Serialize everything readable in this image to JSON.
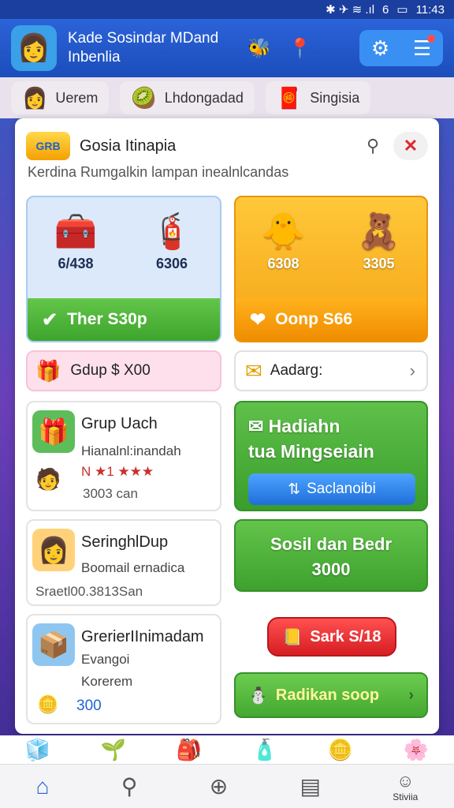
{
  "status": {
    "time": "11:43",
    "battery": "6",
    "signals": "✱ ✈ ≋ .ıl"
  },
  "appbar": {
    "logo": "👩",
    "title_line1": "Kade Sosindar MDand",
    "title_line2": "Inbenlia",
    "icons": [
      "🐝",
      "📍"
    ],
    "action_icons": [
      "⚙",
      "☰"
    ]
  },
  "chips": [
    {
      "icon": "👩",
      "label": "Uerem"
    },
    {
      "icon": "🥝",
      "label": "Lhdongadad"
    },
    {
      "icon": "🧧",
      "label": "Singisia"
    }
  ],
  "panel": {
    "logo": "GRB",
    "title": "Gosia Itinapia",
    "subtitle": "Kerdina Rumgalkin lampan inealnlcandas",
    "blue_card": {
      "items": [
        {
          "icon": "🧰",
          "value": "6/438"
        },
        {
          "icon": "🧯",
          "value": "6306"
        }
      ],
      "bar_icon": "✔",
      "bar_label": "Ther S30p"
    },
    "orange_card": {
      "items": [
        {
          "icon": "🐥",
          "value": "6308"
        },
        {
          "icon": "🧸",
          "value": "3305"
        }
      ],
      "bar_icon": "❤",
      "bar_label": "Oonp S66"
    },
    "pink_row": {
      "icon": "🎁",
      "label": "Gdup $ X00"
    },
    "white_row": {
      "icon": "✉",
      "label": "Aadarg:",
      "chevron": "›"
    },
    "list": [
      {
        "icon": "🎁",
        "title": "Grup Uach",
        "line1": "Hianalnl:inandah",
        "line2": "N ★1 ★★★",
        "foot": "3003 can"
      },
      {
        "icon": "👩",
        "title": "SeringhlDup",
        "line1": "Boomail ernadica",
        "foot": "Sraetl00.3813San"
      },
      {
        "icon": "📦",
        "title": "GrerierIInimadam",
        "line1": "Evangoi",
        "line2": "Korerem",
        "foot": "300"
      }
    ],
    "green_big": {
      "icon": "✉",
      "title_line1": "Hadiahn",
      "title_line2": "tua Mingseiain",
      "button_icon": "⇅",
      "button_label": "Saclanoibi"
    },
    "green_mid": {
      "title_line1": "Sosil dan Bedr",
      "title_line2": "3000"
    },
    "red_button": {
      "icon": "📒",
      "label": "Sark S/18"
    },
    "green_small": {
      "icon": "⛄",
      "label": "Radikan soop",
      "chevron": "›"
    }
  },
  "tabbar_top_icons": [
    "🧊",
    "🌱",
    "🎒",
    "🧴",
    "🪙",
    "🌸"
  ],
  "tabbar": [
    {
      "icon": "⌂",
      "label": ""
    },
    {
      "icon": "⚲",
      "label": ""
    },
    {
      "icon": "⊕",
      "label": ""
    },
    {
      "icon": "▤",
      "label": ""
    },
    {
      "icon": "☺",
      "label": "Stiviia"
    }
  ]
}
